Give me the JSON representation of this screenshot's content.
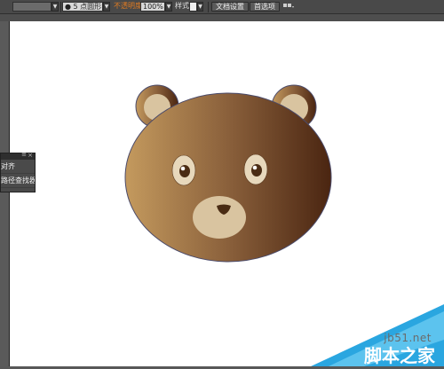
{
  "toolbar": {
    "stroke_dropdown_arrow": "▼",
    "brush_value": "5 点圆形",
    "brush_bullet": "●",
    "opacity_label": "不透明度",
    "opacity_value": "100%",
    "style_label": "样式",
    "document_setup_button": "文档设置",
    "preferences_button": "首选项",
    "arrange_icon": "arrange-documents-icon"
  },
  "panel": {
    "items": [
      {
        "label": "对齐"
      },
      {
        "label": "路径查找器"
      }
    ]
  },
  "artwork": {
    "description_kind": "bear face vector",
    "colors": {
      "gradient_light": "#c49a5e",
      "gradient_mid": "#8a603b",
      "gradient_dark": "#4a2511",
      "ear_inner": "#d9c4a0",
      "muzzle": "#d9c4a0",
      "eye_white": "#e7d8bc",
      "pupil": "#4a2c14",
      "outline": "#4a4a6a"
    }
  },
  "watermark": {
    "site": "jb51.net",
    "name": "脚本之家"
  }
}
